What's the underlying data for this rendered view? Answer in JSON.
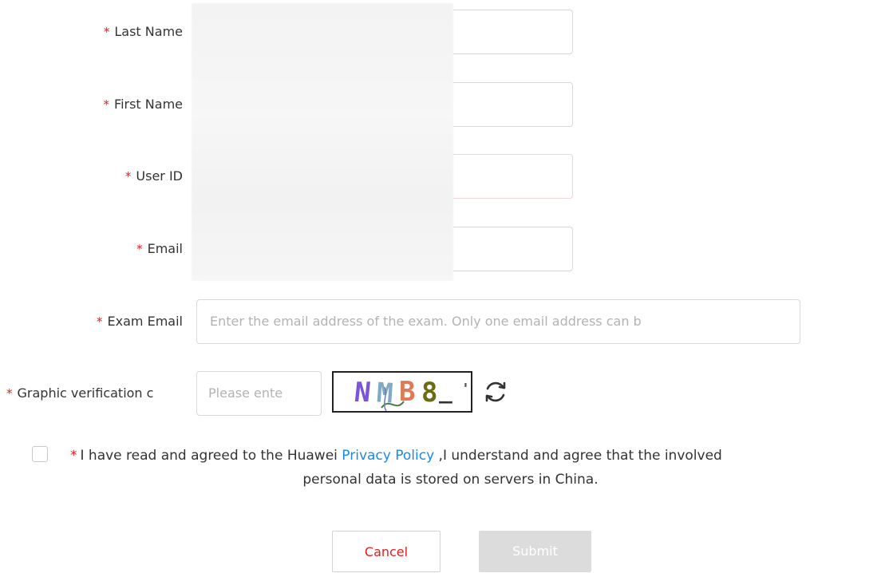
{
  "form": {
    "required_mark": "*",
    "fields": {
      "last_name": {
        "label": "Last Name",
        "value": ""
      },
      "first_name": {
        "label": "First Name",
        "value": ""
      },
      "user_id": {
        "label": "User ID",
        "value": ""
      },
      "email": {
        "label": "Email",
        "value": ""
      },
      "exam_email": {
        "label": "Exam Email",
        "placeholder": "Enter the email address of the exam. Only one email address can b"
      },
      "captcha": {
        "label": "Graphic verification c",
        "placeholder": "Please ente",
        "image_text": "NMB8_",
        "icon": "refresh-icon"
      }
    },
    "agreement": {
      "text_before": "I have read and agreed to the Huawei ",
      "link": "Privacy Policy",
      "text_after": " ,I understand and agree that the involved",
      "text_line2": "personal data is stored on servers in China.",
      "checked": false
    },
    "buttons": {
      "cancel": "Cancel",
      "submit": "Submit"
    }
  },
  "colors": {
    "required": "#e02020",
    "link": "#1e88e5",
    "disabled_button": "#dcdcdc",
    "border": "#d9d9d9"
  }
}
